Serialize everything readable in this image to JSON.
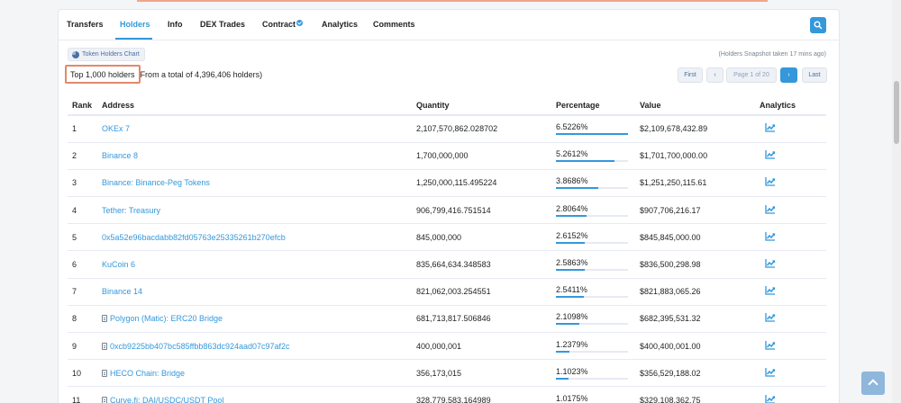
{
  "tabs": [
    {
      "label": "Transfers"
    },
    {
      "label": "Holders"
    },
    {
      "label": "Info"
    },
    {
      "label": "DEX Trades"
    },
    {
      "label": "Contract"
    },
    {
      "label": "Analytics"
    },
    {
      "label": "Comments"
    }
  ],
  "toolbar": {
    "chart_button": "Token Holders Chart",
    "snapshot": "(Holders Snapshot taken 17 mins ago)"
  },
  "summary": {
    "highlight": "Top 1,000 holders",
    "rest": "From a total of 4,396,406 holders)"
  },
  "pager": {
    "first": "First",
    "prev": "‹",
    "page": "Page 1 of 20",
    "next": "›",
    "last": "Last"
  },
  "table": {
    "headers": [
      "Rank",
      "Address",
      "Quantity",
      "Percentage",
      "Value",
      "Analytics"
    ],
    "rows": [
      {
        "rank": "1",
        "address": "OKEx 7",
        "contract": false,
        "quantity": "2,107,570,862.028702",
        "percentage": "6.5226%",
        "pct": 6.5226,
        "value": "$2,109,678,432.89"
      },
      {
        "rank": "2",
        "address": "Binance 8",
        "contract": false,
        "quantity": "1,700,000,000",
        "percentage": "5.2612%",
        "pct": 5.2612,
        "value": "$1,701,700,000.00"
      },
      {
        "rank": "3",
        "address": "Binance: Binance-Peg Tokens",
        "contract": false,
        "quantity": "1,250,000,115.495224",
        "percentage": "3.8686%",
        "pct": 3.8686,
        "value": "$1,251,250,115.61"
      },
      {
        "rank": "4",
        "address": "Tether: Treasury",
        "contract": false,
        "quantity": "906,799,416.751514",
        "percentage": "2.8064%",
        "pct": 2.8064,
        "value": "$907,706,216.17"
      },
      {
        "rank": "5",
        "address": "0x5a52e96bacdabb82fd05763e25335261b270efcb",
        "contract": false,
        "quantity": "845,000,000",
        "percentage": "2.6152%",
        "pct": 2.6152,
        "value": "$845,845,000.00"
      },
      {
        "rank": "6",
        "address": "KuCoin 6",
        "contract": false,
        "quantity": "835,664,634.348583",
        "percentage": "2.5863%",
        "pct": 2.5863,
        "value": "$836,500,298.98"
      },
      {
        "rank": "7",
        "address": "Binance 14",
        "contract": false,
        "quantity": "821,062,003.254551",
        "percentage": "2.5411%",
        "pct": 2.5411,
        "value": "$821,883,065.26"
      },
      {
        "rank": "8",
        "address": "Polygon (Matic): ERC20 Bridge",
        "contract": true,
        "quantity": "681,713,817.506846",
        "percentage": "2.1098%",
        "pct": 2.1098,
        "value": "$682,395,531.32"
      },
      {
        "rank": "9",
        "address": "0xcb9225bb407bc585ffbb863dc924aad07c97af2c",
        "contract": true,
        "quantity": "400,000,001",
        "percentage": "1.2379%",
        "pct": 1.2379,
        "value": "$400,400,001.00"
      },
      {
        "rank": "10",
        "address": "HECO Chain: Bridge",
        "contract": true,
        "quantity": "356,173,015",
        "percentage": "1.1023%",
        "pct": 1.1023,
        "value": "$356,529,188.02"
      },
      {
        "rank": "11",
        "address": "Curve.fi: DAI/USDC/USDT Pool",
        "contract": true,
        "quantity": "328,779,583.164989",
        "percentage": "1.0175%",
        "pct": 1.0175,
        "value": "$329,108,362.75"
      }
    ]
  },
  "colors": {
    "accent": "#3498db",
    "highlight_border": "#e3896a",
    "text": "#1e2022"
  },
  "icons": [
    "search-icon",
    "pie-chart-icon",
    "verified-check-icon",
    "contract-file-icon",
    "analytics-chart-icon",
    "arrow-up-icon"
  ]
}
